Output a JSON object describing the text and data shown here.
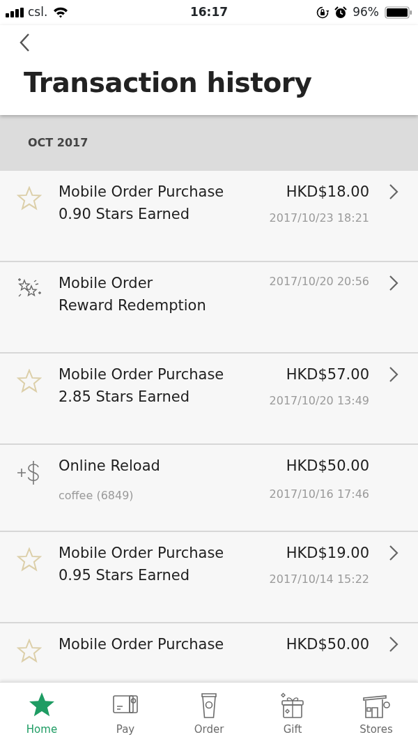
{
  "status_bar": {
    "carrier": "csl.",
    "time": "16:17",
    "battery": "96%"
  },
  "header": {
    "title": "Transaction history"
  },
  "month": "OCT 2017",
  "transactions": [
    {
      "kind": "purchase",
      "title": "Mobile Order Purchase",
      "subtitle": "0.90 Stars Earned",
      "amount": "HKD$18.00",
      "time": "2017/10/23 18:21",
      "has_detail": true
    },
    {
      "kind": "redemption",
      "title": "Mobile Order",
      "subtitle": "Reward Redemption",
      "time": "2017/10/20 20:56",
      "has_detail": true
    },
    {
      "kind": "purchase",
      "title": "Mobile Order Purchase",
      "subtitle": "2.85 Stars Earned",
      "amount": "HKD$57.00",
      "time": "2017/10/20 13:49",
      "has_detail": true
    },
    {
      "kind": "reload",
      "title": "Online Reload",
      "note": "coffee (6849)",
      "amount": "HKD$50.00",
      "time": "2017/10/16 17:46",
      "has_detail": false
    },
    {
      "kind": "purchase",
      "title": "Mobile Order Purchase",
      "subtitle": "0.95 Stars Earned",
      "amount": "HKD$19.00",
      "time": "2017/10/14 15:22",
      "has_detail": true
    },
    {
      "kind": "purchase",
      "title": "Mobile Order Purchase",
      "amount": "HKD$50.00",
      "has_detail": true
    }
  ],
  "tab_bar": [
    {
      "kind": "home",
      "label": "Home",
      "selected": true
    },
    {
      "kind": "pay",
      "label": "Pay",
      "selected": false
    },
    {
      "kind": "order",
      "label": "Order",
      "selected": false
    },
    {
      "kind": "gift",
      "label": "Gift",
      "selected": false
    },
    {
      "kind": "stores",
      "label": "Stores",
      "selected": false
    }
  ]
}
